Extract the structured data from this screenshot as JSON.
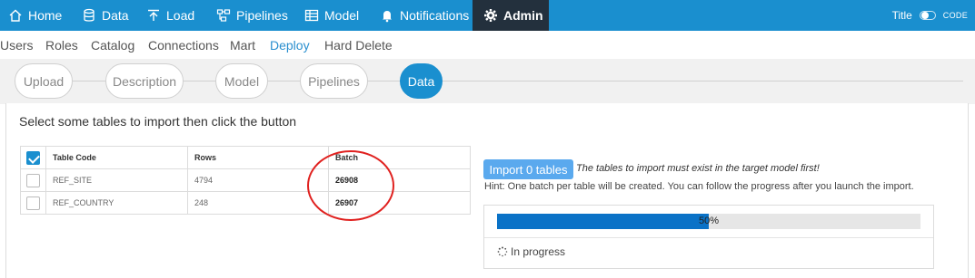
{
  "topnav": {
    "items": [
      {
        "label": "Home",
        "icon": "home-icon"
      },
      {
        "label": "Data",
        "icon": "database-icon"
      },
      {
        "label": "Load",
        "icon": "upload-icon"
      },
      {
        "label": "Pipelines",
        "icon": "pipeline-icon"
      },
      {
        "label": "Model",
        "icon": "model-icon"
      },
      {
        "label": "Notifications",
        "icon": "bell-icon"
      },
      {
        "label": "Admin",
        "icon": "gear-icon",
        "active": true
      }
    ],
    "title_toggle_label": "Title",
    "code_label": "CODE"
  },
  "subnav": {
    "items": [
      "Users",
      "Roles",
      "Catalog",
      "Connections",
      "Mart",
      "Deploy",
      "Hard Delete"
    ],
    "active": "Deploy"
  },
  "steps": [
    "Upload",
    "Description",
    "Model",
    "Pipelines",
    "Data"
  ],
  "active_step": "Data",
  "instruction": "Select some tables to import then click the button",
  "table": {
    "headers": [
      "Table Code",
      "Rows",
      "Batch"
    ],
    "rows": [
      {
        "code": "REF_SITE",
        "rows": "4794",
        "batch": "26908"
      },
      {
        "code": "REF_COUNTRY",
        "rows": "248",
        "batch": "26907"
      }
    ]
  },
  "import": {
    "button_label": "Import 0 tables",
    "note": "The tables to import must exist in the target model first!",
    "hint": "Hint: One batch per table will be created. You can follow the progress after you launch the import."
  },
  "progress": {
    "percent": 50,
    "label": "50%",
    "status": "In progress"
  },
  "colors": {
    "primary": "#1a8fcf",
    "admin_bg": "#23303d",
    "progress": "#0a72c7",
    "annotation": "#e0211f"
  }
}
